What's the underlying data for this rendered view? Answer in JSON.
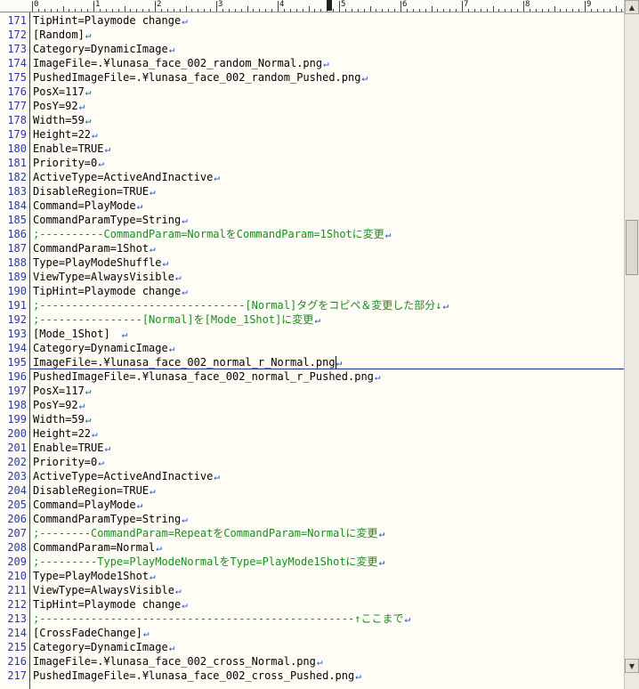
{
  "ruler": {
    "numbers": [
      "0",
      "1",
      "2",
      "3",
      "4",
      "5",
      "6",
      "7",
      "8",
      "9"
    ]
  },
  "editor": {
    "lines": [
      {
        "n": "171",
        "text": "TipHint=Playmode change",
        "type": "normal"
      },
      {
        "n": "172",
        "text": "[Random]",
        "type": "normal"
      },
      {
        "n": "173",
        "text": "Category=DynamicImage",
        "type": "normal"
      },
      {
        "n": "174",
        "text": "ImageFile=.¥lunasa_face_002_random_Normal.png",
        "type": "normal"
      },
      {
        "n": "175",
        "text": "PushedImageFile=.¥lunasa_face_002_random_Pushed.png",
        "type": "normal"
      },
      {
        "n": "176",
        "text": "PosX=117",
        "type": "normal"
      },
      {
        "n": "177",
        "text": "PosY=92",
        "type": "normal"
      },
      {
        "n": "178",
        "text": "Width=59",
        "type": "normal"
      },
      {
        "n": "179",
        "text": "Height=22",
        "type": "normal"
      },
      {
        "n": "180",
        "text": "Enable=TRUE",
        "type": "normal"
      },
      {
        "n": "181",
        "text": "Priority=0",
        "type": "normal"
      },
      {
        "n": "182",
        "text": "ActiveType=ActiveAndInactive",
        "type": "normal"
      },
      {
        "n": "183",
        "text": "DisableRegion=TRUE",
        "type": "normal"
      },
      {
        "n": "184",
        "text": "Command=PlayMode",
        "type": "normal"
      },
      {
        "n": "185",
        "text": "CommandParamType=String",
        "type": "normal"
      },
      {
        "n": "186",
        "text": ";----------CommandParam=NormalをCommandParam=1Shotに変更",
        "type": "comment"
      },
      {
        "n": "187",
        "text": "CommandParam=1Shot",
        "type": "normal"
      },
      {
        "n": "188",
        "text": "Type=PlayModeShuffle",
        "type": "normal"
      },
      {
        "n": "189",
        "text": "ViewType=AlwaysVisible",
        "type": "normal"
      },
      {
        "n": "190",
        "text": "TipHint=Playmode change",
        "type": "normal"
      },
      {
        "n": "191",
        "text": ";--------------------------------[Normal]タグをコピペ＆変更した部分↓",
        "type": "comment"
      },
      {
        "n": "192",
        "text": ";----------------[Normal]を[Mode_1Shot]に変更",
        "type": "comment"
      },
      {
        "n": "193",
        "text": "[Mode_1Shot]　",
        "type": "normal"
      },
      {
        "n": "194",
        "text": "Category=DynamicImage",
        "type": "normal"
      },
      {
        "n": "195",
        "text": "ImageFile=.¥lunasa_face_002_normal_r_Normal.png",
        "type": "normal"
      },
      {
        "n": "196",
        "text": "PushedImageFile=.¥lunasa_face_002_normal_r_Pushed.png",
        "type": "normal"
      },
      {
        "n": "197",
        "text": "PosX=117",
        "type": "normal"
      },
      {
        "n": "198",
        "text": "PosY=92",
        "type": "normal"
      },
      {
        "n": "199",
        "text": "Width=59",
        "type": "normal"
      },
      {
        "n": "200",
        "text": "Height=22",
        "type": "normal"
      },
      {
        "n": "201",
        "text": "Enable=TRUE",
        "type": "normal"
      },
      {
        "n": "202",
        "text": "Priority=0",
        "type": "normal"
      },
      {
        "n": "203",
        "text": "ActiveType=ActiveAndInactive",
        "type": "normal"
      },
      {
        "n": "204",
        "text": "DisableRegion=TRUE",
        "type": "normal"
      },
      {
        "n": "205",
        "text": "Command=PlayMode",
        "type": "normal"
      },
      {
        "n": "206",
        "text": "CommandParamType=String",
        "type": "normal"
      },
      {
        "n": "207",
        "text": ";--------CommandParam=RepeatをCommandParam=Normalに変更",
        "type": "comment"
      },
      {
        "n": "208",
        "text": "CommandParam=Normal",
        "type": "normal"
      },
      {
        "n": "209",
        "text": ";---------Type=PlayModeNormalをType=PlayMode1Shotに変更",
        "type": "comment"
      },
      {
        "n": "210",
        "text": "Type=PlayMode1Shot",
        "type": "normal"
      },
      {
        "n": "211",
        "text": "ViewType=AlwaysVisible",
        "type": "normal"
      },
      {
        "n": "212",
        "text": "TipHint=Playmode change",
        "type": "normal"
      },
      {
        "n": "213",
        "text": ";-------------------------------------------------↑ここまで",
        "type": "comment"
      },
      {
        "n": "214",
        "text": "[CrossFadeChange]",
        "type": "normal"
      },
      {
        "n": "215",
        "text": "Category=DynamicImage",
        "type": "normal"
      },
      {
        "n": "216",
        "text": "ImageFile=.¥lunasa_face_002_cross_Normal.png",
        "type": "normal"
      },
      {
        "n": "217",
        "text": "PushedImageFile=.¥lunasa_face_002_cross_Pushed.png",
        "type": "normal"
      }
    ],
    "eol_marker": "↵",
    "current_line": "195"
  },
  "icons": {
    "scroll_up": "scroll-up-arrow-icon",
    "scroll_down": "scroll-down-arrow-icon"
  },
  "colors": {
    "background": "#fffdf5",
    "line_number": "#2b38a0",
    "comment": "#1d8c1d",
    "eol_marker": "#1f4fd6"
  }
}
